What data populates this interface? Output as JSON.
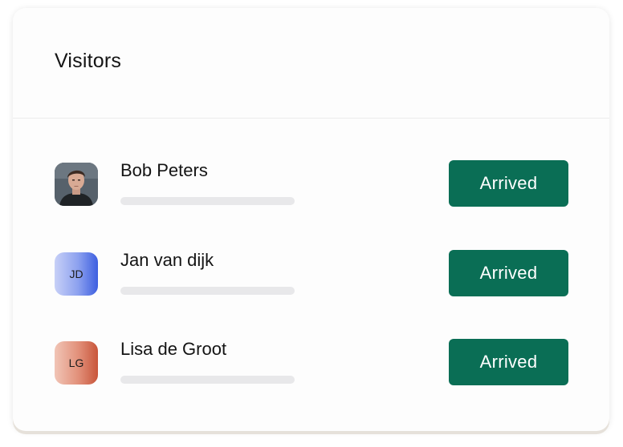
{
  "card": {
    "title": "Visitors"
  },
  "visitors": [
    {
      "name_first": "Bob Peters",
      "name_rest": "",
      "avatar": {
        "type": "photo",
        "icon": "person-photo-icon"
      },
      "status": "Arrived"
    },
    {
      "name_first": "Jan van dijk",
      "name_rest": "",
      "avatar": {
        "type": "initials",
        "initials": "JD",
        "gradient": [
          "#c7d0f7",
          "#3d5fe0"
        ]
      },
      "status": "Arrived"
    },
    {
      "name_first": "Lisa",
      "name_rest": " de Groot",
      "avatar": {
        "type": "initials",
        "initials": "LG",
        "gradient": [
          "#f1c5b6",
          "#c8553a"
        ]
      },
      "status": "Arrived"
    }
  ],
  "colors": {
    "status_button": "#0a6e55",
    "status_text": "#ffffff",
    "placeholder_bar": "#e8e8ea"
  }
}
